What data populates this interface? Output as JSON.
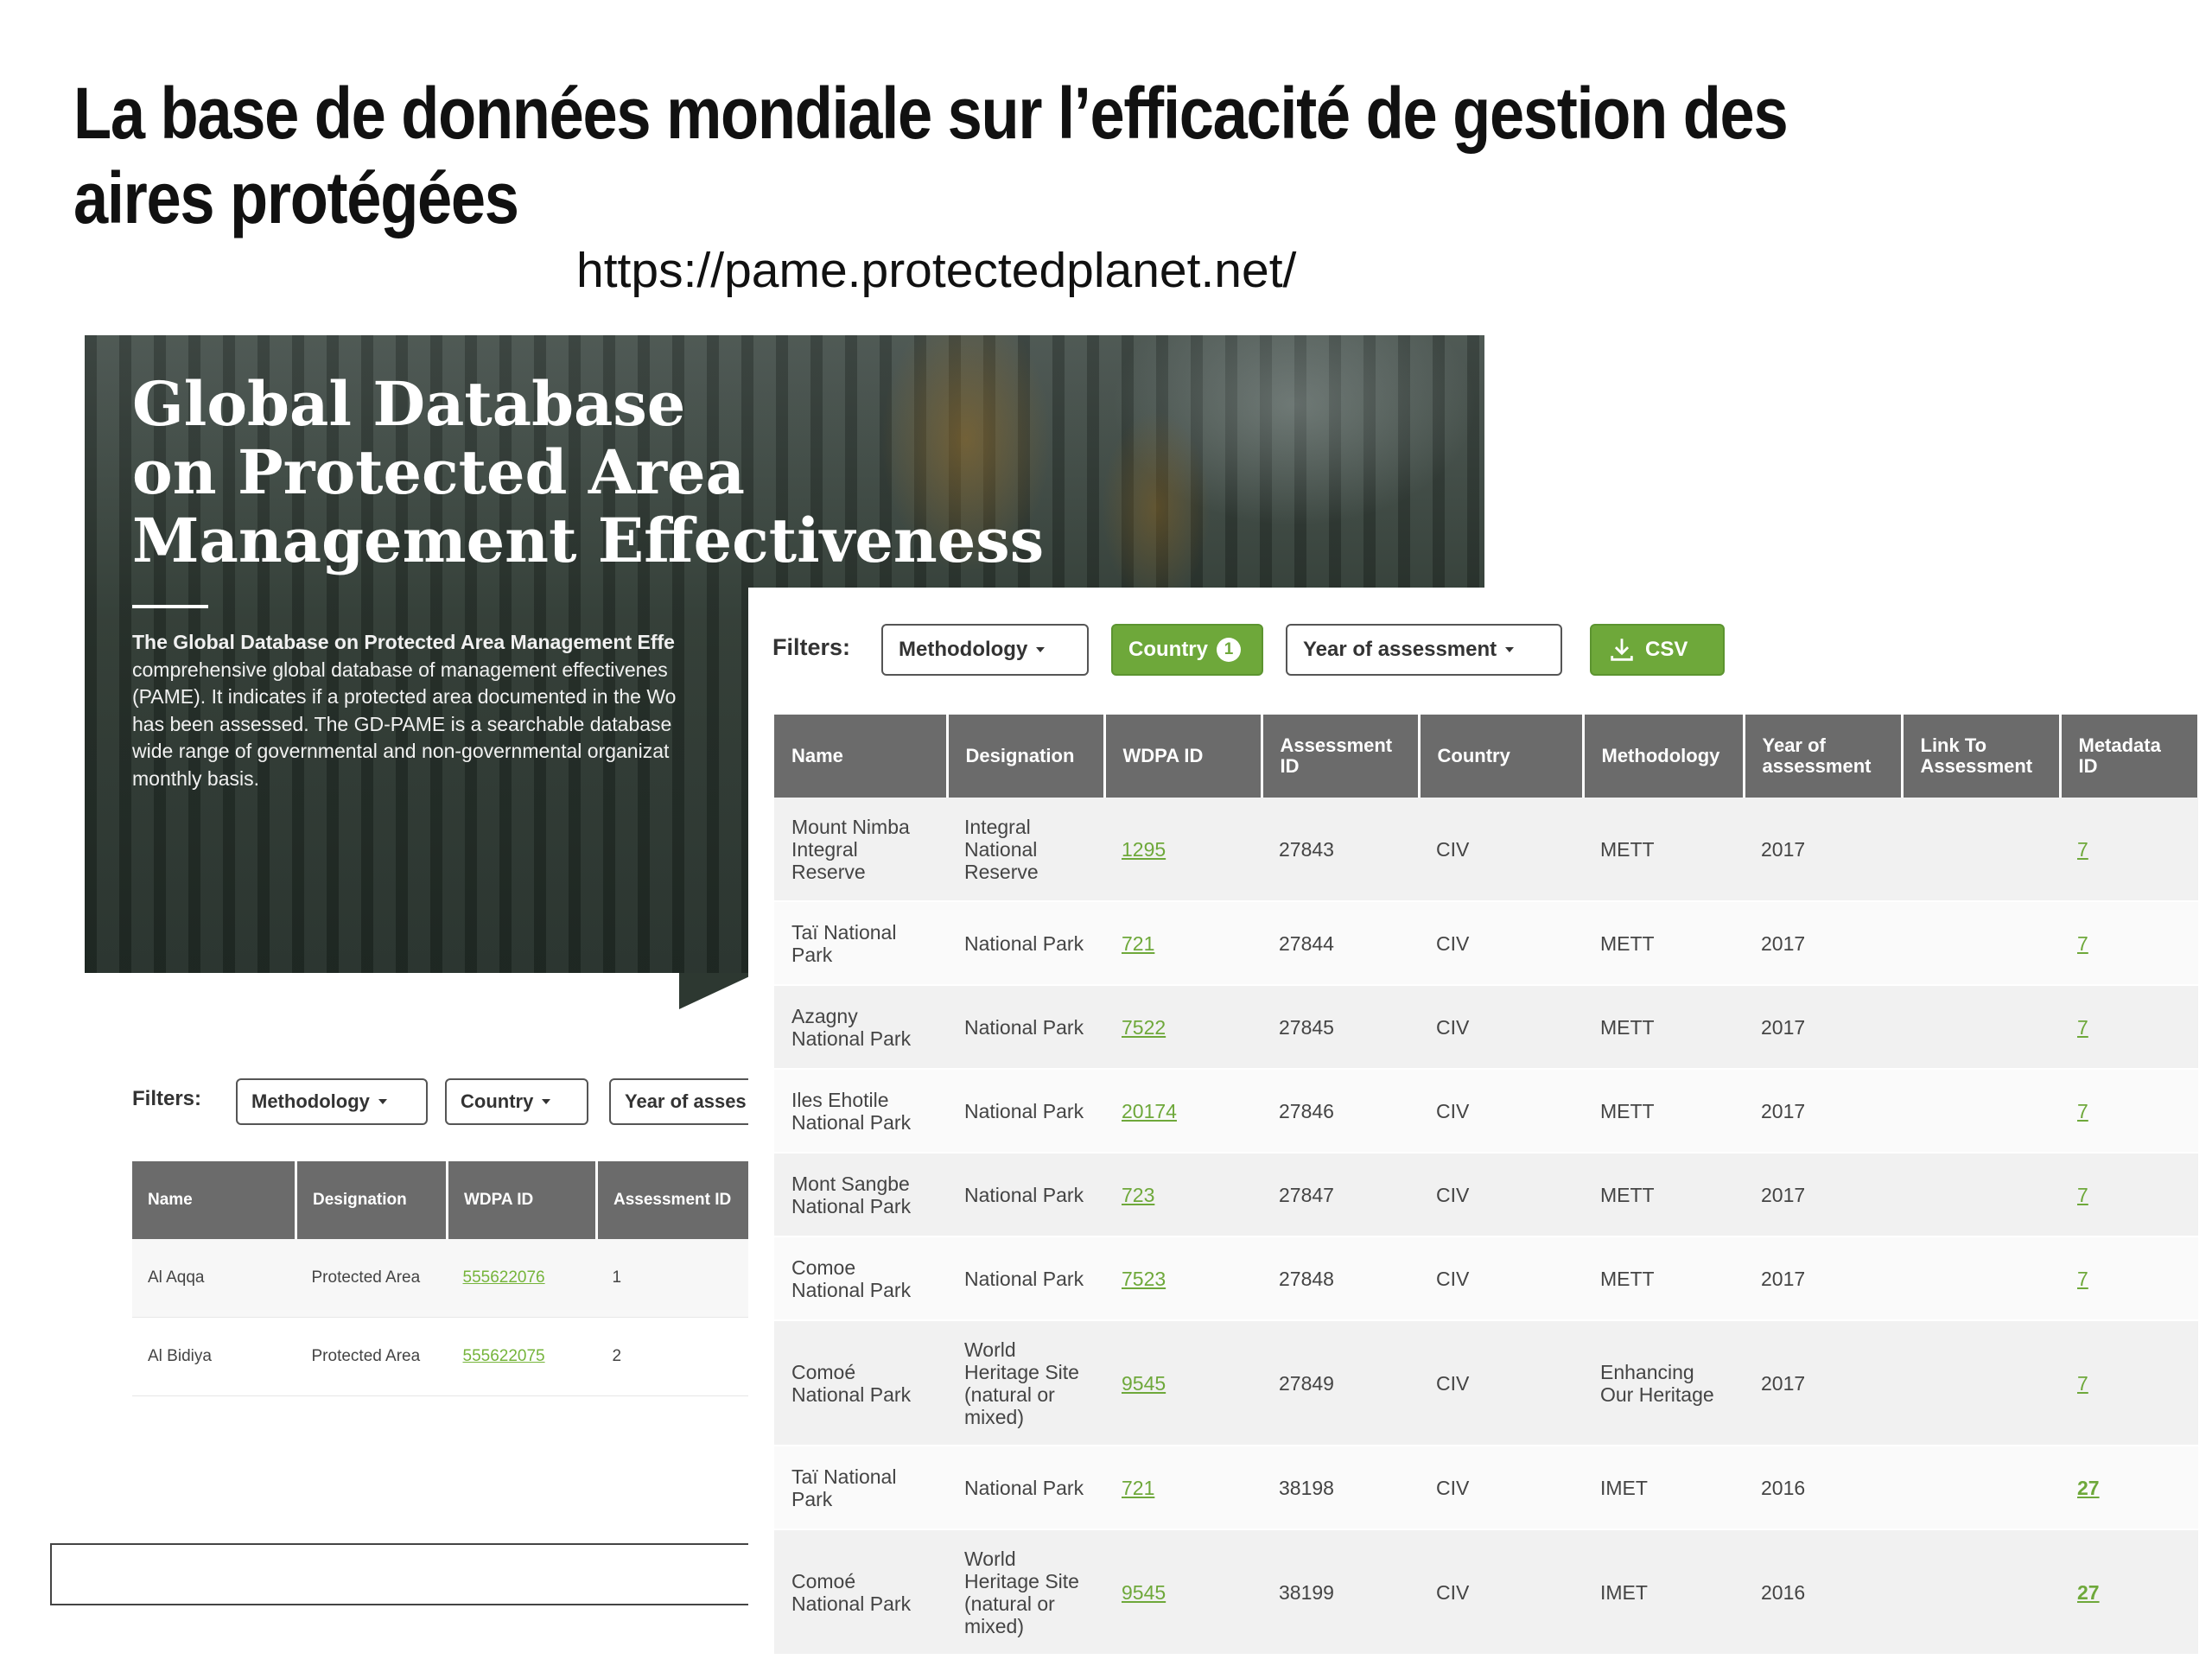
{
  "slide": {
    "title": "La base de données mondiale sur l’efficacité de gestion des aires protégées",
    "url": "https://pame.protectedplanet.net/"
  },
  "back_screenshot": {
    "hero_title_lines": [
      "Global Database",
      "on Protected Area",
      "Management Effectiveness"
    ],
    "description_lines": [
      "The Global Database on Protected Area Management Effe",
      "comprehensive global database of management effectivenes",
      "(PAME). It indicates if a protected area documented in the Wo",
      "has been assessed. The GD-PAME is a searchable database",
      "wide range of governmental and non-governmental organizat",
      "monthly basis."
    ],
    "filters_label": "Filters:",
    "filters": [
      "Methodology",
      "Country",
      "Year of asses"
    ],
    "table": {
      "headers": [
        "Name",
        "Designation",
        "WDPA ID",
        "Assessment ID"
      ],
      "rows": [
        [
          "Al Aqqa",
          "Protected Area",
          "555622076",
          "1"
        ],
        [
          "Al Bidiya",
          "Protected Area",
          "555622075",
          "2"
        ]
      ]
    }
  },
  "front_screenshot": {
    "filters_label": "Filters:",
    "filters": {
      "methodology": "Methodology",
      "country": "Country",
      "country_count": "1",
      "year": "Year of assessment",
      "csv": "CSV"
    },
    "colors": {
      "accent_green": "#6ea83a",
      "header_gray": "#6b6b6b"
    },
    "table": {
      "headers": [
        "Name",
        "Designation",
        "WDPA ID",
        "Assessment ID",
        "Country",
        "Methodology",
        "Year of assessment",
        "Link To Assessment",
        "Metadata ID"
      ],
      "rows": [
        [
          "Mount Nimba Integral Reserve",
          "Integral National Reserve",
          "1295",
          "27843",
          "CIV",
          "METT",
          "2017",
          "",
          "7"
        ],
        [
          "Taï National Park",
          "National Park",
          "721",
          "27844",
          "CIV",
          "METT",
          "2017",
          "",
          "7"
        ],
        [
          "Azagny National Park",
          "National Park",
          "7522",
          "27845",
          "CIV",
          "METT",
          "2017",
          "",
          "7"
        ],
        [
          "Iles Ehotile National Park",
          "National Park",
          "20174",
          "27846",
          "CIV",
          "METT",
          "2017",
          "",
          "7"
        ],
        [
          "Mont Sangbe National Park",
          "National Park",
          "723",
          "27847",
          "CIV",
          "METT",
          "2017",
          "",
          "7"
        ],
        [
          "Comoe National Park",
          "National Park",
          "7523",
          "27848",
          "CIV",
          "METT",
          "2017",
          "",
          "7"
        ],
        [
          "Comoé National Park",
          "World Heritage Site (natural or mixed)",
          "9545",
          "27849",
          "CIV",
          "Enhancing Our Heritage",
          "2017",
          "",
          "7"
        ],
        [
          "Taï National Park",
          "National Park",
          "721",
          "38198",
          "CIV",
          "IMET",
          "2016",
          "",
          "27"
        ],
        [
          "Comoé National Park",
          "World Heritage Site (natural or mixed)",
          "9545",
          "38199",
          "CIV",
          "IMET",
          "2016",
          "",
          "27"
        ]
      ]
    }
  }
}
